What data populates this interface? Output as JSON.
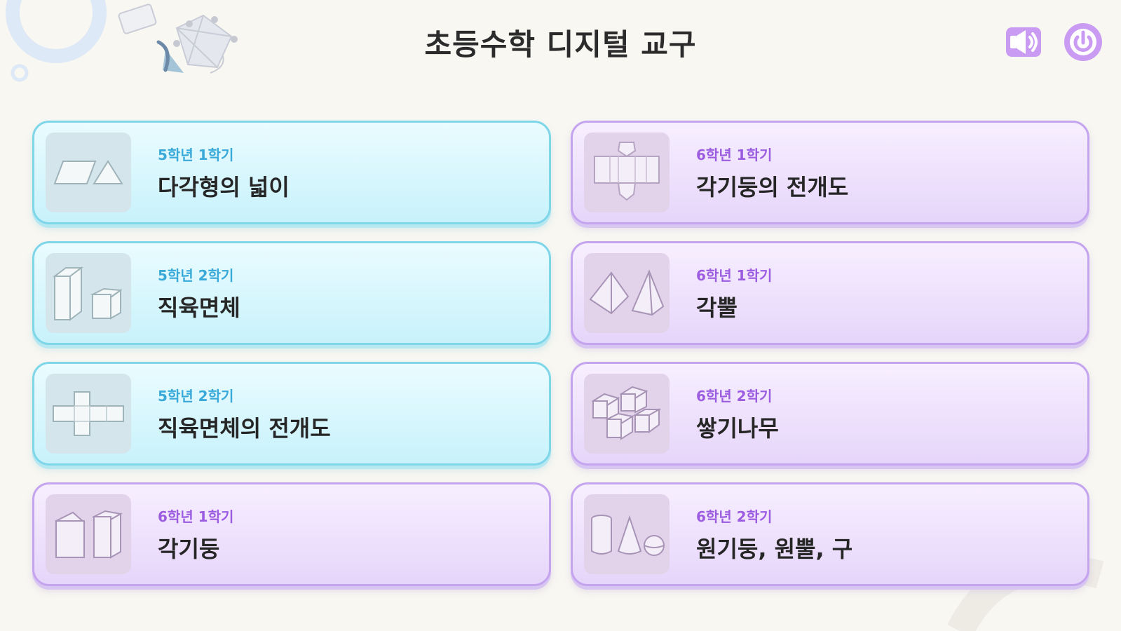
{
  "header": {
    "title": "초등수학 디지털 교구",
    "sound_icon": "speaker-icon",
    "power_icon": "power-icon",
    "accent": "#c08cf0"
  },
  "cards": [
    {
      "grade": "5학년 1학기",
      "name": "다각형의 넓이",
      "icon": "parallelogram-triangle-icon",
      "theme": "#7fd6e8"
    },
    {
      "grade": "6학년 1학기",
      "name": "각기둥의 전개도",
      "icon": "prism-net-icon",
      "theme": "#c4a4ee"
    },
    {
      "grade": "5학년 2학기",
      "name": "직육면체",
      "icon": "cuboid-icon",
      "theme": "#7fd6e8"
    },
    {
      "grade": "6학년 1학기",
      "name": "각뿔",
      "icon": "pyramid-icon",
      "theme": "#c4a4ee"
    },
    {
      "grade": "5학년 2학기",
      "name": "직육면체의 전개도",
      "icon": "cube-net-icon",
      "theme": "#7fd6e8"
    },
    {
      "grade": "6학년 2학기",
      "name": "쌓기나무",
      "icon": "stacked-cubes-icon",
      "theme": "#c4a4ee"
    },
    {
      "grade": "6학년 1학기",
      "name": "각기둥",
      "icon": "prism-icon",
      "theme": "#c4a4ee"
    },
    {
      "grade": "6학년 2학기",
      "name": "원기둥, 원뿔, 구",
      "icon": "cylinder-cone-sphere-icon",
      "theme": "#c4a4ee"
    }
  ]
}
